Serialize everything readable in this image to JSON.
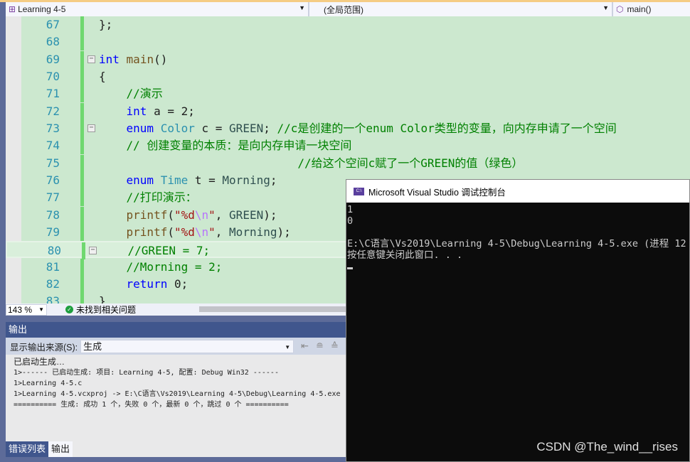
{
  "navbar": {
    "project": "Learning 4-5",
    "scope": "(全局范围)",
    "member": "main()"
  },
  "editor": {
    "lines": [
      {
        "n": "67",
        "fold": false,
        "tokens": [
          [
            "tx",
            "};"
          ]
        ]
      },
      {
        "n": "68",
        "fold": false,
        "tokens": []
      },
      {
        "n": "69",
        "fold": true,
        "tokens": [
          [
            "kw",
            "int"
          ],
          [
            "tx",
            " "
          ],
          [
            "fn",
            "main"
          ],
          [
            "tx",
            "()"
          ]
        ]
      },
      {
        "n": "70",
        "fold": false,
        "tokens": [
          [
            "tx",
            "{"
          ]
        ]
      },
      {
        "n": "71",
        "fold": false,
        "tokens": [
          [
            "tx",
            "    "
          ],
          [
            "cm",
            "//演示"
          ]
        ]
      },
      {
        "n": "72",
        "fold": false,
        "tokens": [
          [
            "tx",
            "    "
          ],
          [
            "kw",
            "int"
          ],
          [
            "tx",
            " a = 2;"
          ]
        ]
      },
      {
        "n": "73",
        "fold": true,
        "tokens": [
          [
            "tx",
            "    "
          ],
          [
            "kw",
            "enum"
          ],
          [
            "tx",
            " "
          ],
          [
            "ty",
            "Color"
          ],
          [
            "tx",
            " c = "
          ],
          [
            "en",
            "GREEN"
          ],
          [
            "tx",
            "; "
          ],
          [
            "cm",
            "//c是创建的一个enum Color类型的变量，向内存申请了一个空间"
          ]
        ]
      },
      {
        "n": "74",
        "fold": false,
        "tokens": [
          [
            "tx",
            "    "
          ],
          [
            "cm",
            "// 创建变量的本质：是向内存申请一块空间"
          ]
        ]
      },
      {
        "n": "75",
        "fold": false,
        "tokens": [
          [
            "tx",
            "                             "
          ],
          [
            "cm",
            "//给这个空间c赋了一个GREEN的值（绿色）"
          ]
        ]
      },
      {
        "n": "76",
        "fold": false,
        "tokens": [
          [
            "tx",
            "    "
          ],
          [
            "kw",
            "enum"
          ],
          [
            "tx",
            " "
          ],
          [
            "ty",
            "Time"
          ],
          [
            "tx",
            " t = "
          ],
          [
            "en",
            "Morning"
          ],
          [
            "tx",
            ";"
          ]
        ]
      },
      {
        "n": "77",
        "fold": false,
        "tokens": [
          [
            "tx",
            "    "
          ],
          [
            "cm",
            "//打印演示："
          ]
        ]
      },
      {
        "n": "78",
        "fold": false,
        "tokens": [
          [
            "tx",
            "    "
          ],
          [
            "fn",
            "printf"
          ],
          [
            "tx",
            "("
          ],
          [
            "st",
            "\"%d"
          ],
          [
            "es",
            "\\n"
          ],
          [
            "st",
            "\""
          ],
          [
            "tx",
            ", "
          ],
          [
            "en",
            "GREEN"
          ],
          [
            "tx",
            ");"
          ]
        ]
      },
      {
        "n": "79",
        "fold": false,
        "tokens": [
          [
            "tx",
            "    "
          ],
          [
            "fn",
            "printf"
          ],
          [
            "tx",
            "("
          ],
          [
            "st",
            "\"%d"
          ],
          [
            "es",
            "\\n"
          ],
          [
            "st",
            "\""
          ],
          [
            "tx",
            ", "
          ],
          [
            "en",
            "Morning"
          ],
          [
            "tx",
            ");"
          ]
        ]
      },
      {
        "n": "80",
        "fold": true,
        "current": true,
        "tokens": [
          [
            "tx",
            "    "
          ],
          [
            "cm",
            "//GREEN = 7;"
          ]
        ]
      },
      {
        "n": "81",
        "fold": false,
        "tokens": [
          [
            "tx",
            "    "
          ],
          [
            "cm",
            "//Morning = 2;"
          ]
        ]
      },
      {
        "n": "82",
        "fold": false,
        "tokens": [
          [
            "tx",
            "    "
          ],
          [
            "kw",
            "return"
          ],
          [
            "tx",
            " 0;"
          ]
        ]
      },
      {
        "n": "83",
        "fold": false,
        "tokens": [
          [
            "tx",
            "}"
          ]
        ]
      }
    ]
  },
  "status": {
    "zoom": "143 %",
    "issues": "未找到相关问题"
  },
  "output": {
    "title": "输出",
    "source_label": "显示输出来源(S):",
    "source_value": "生成",
    "lines": [
      "已启动生成…",
      "1>------ 已启动生成: 项目: Learning 4-5, 配置: Debug Win32 ------",
      "1>Learning 4-5.c",
      "1>Learning 4-5.vcxproj -> E:\\C语言\\Vs2019\\Learning 4-5\\Debug\\Learning 4-5.exe",
      "========== 生成: 成功 1 个，失败 0 个，最新 0 个，跳过 0 个 =========="
    ]
  },
  "tabs": [
    "错误列表",
    "输出"
  ],
  "console": {
    "title": "Microsoft Visual Studio 调试控制台",
    "icon_text": "C:\\",
    "lines": [
      "1",
      "0",
      "",
      "E:\\C语言\\Vs2019\\Learning 4-5\\Debug\\Learning 4-5.exe (进程 12",
      "按任意键关闭此窗口. . ."
    ]
  },
  "watermark": "CSDN @The_wind__rises"
}
